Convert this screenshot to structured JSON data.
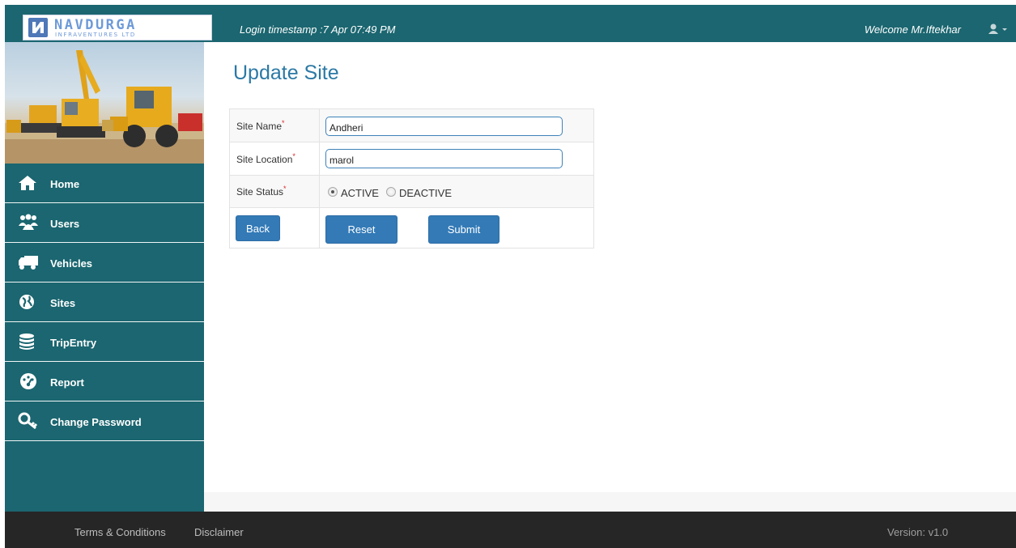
{
  "header": {
    "logo_name": "NAVDURGA",
    "logo_sub": "INFRAVENTURES LTD",
    "login_timestamp": "Login timestamp :7 Apr 07:49 PM",
    "welcome": "Welcome Mr.Iftekhar",
    "user_icon": "user-icon",
    "menu_caret_icon": "caret-down-icon"
  },
  "sidebar": {
    "items": [
      {
        "label": "Home",
        "icon": "home-icon"
      },
      {
        "label": "Users",
        "icon": "users-icon"
      },
      {
        "label": "Vehicles",
        "icon": "truck-icon"
      },
      {
        "label": "Sites",
        "icon": "globe-icon"
      },
      {
        "label": "TripEntry",
        "icon": "database-icon"
      },
      {
        "label": "Report",
        "icon": "dashboard-icon"
      },
      {
        "label": "Change Password",
        "icon": "key-icon"
      }
    ]
  },
  "main": {
    "title": "Update Site",
    "form": {
      "site_name_label": "Site Name",
      "site_name_value": "Andheri",
      "site_location_label": "Site Location",
      "site_location_value": "marol",
      "required_mark": "*",
      "site_status_label": "Site Status",
      "status_options": [
        "ACTIVE",
        "DEACTIVE"
      ],
      "status_selected": "ACTIVE",
      "back_label": "Back",
      "reset_label": "Reset",
      "submit_label": "Submit"
    }
  },
  "footer": {
    "terms": "Terms & Conditions",
    "disclaimer": "Disclaimer",
    "version": "Version: v1.0"
  },
  "colors": {
    "header_bg": "#1b6670",
    "sidebar_bg": "#1b6670",
    "title_color": "#2b79a5",
    "button_bg": "#337ab7",
    "footer_bg": "#262626",
    "required_color": "#d9252b"
  }
}
